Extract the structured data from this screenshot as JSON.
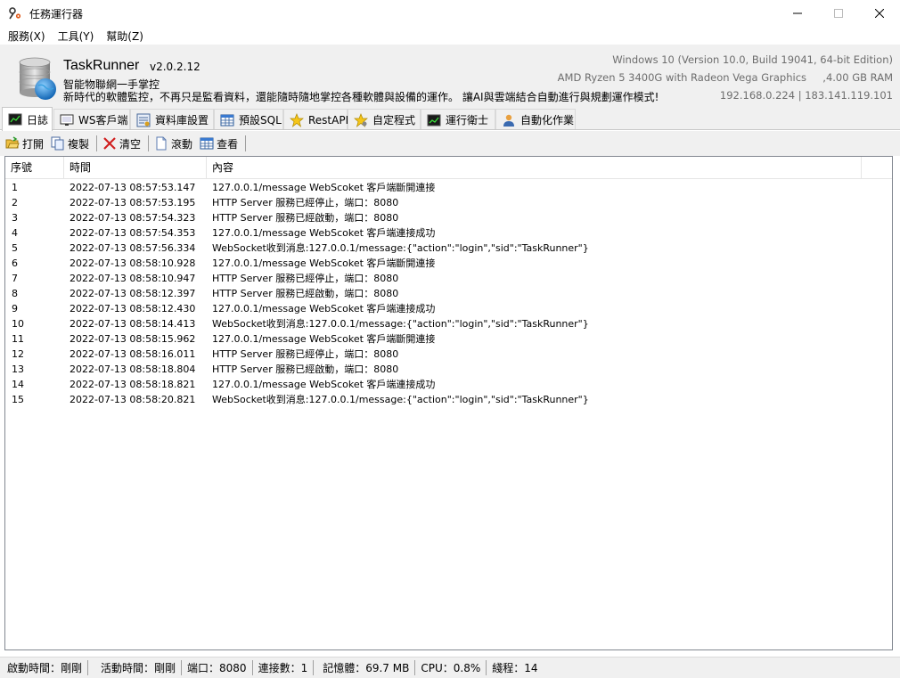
{
  "window": {
    "title": "任務運行器"
  },
  "menu": [
    {
      "label": "服務(X)"
    },
    {
      "label": "工具(Y)"
    },
    {
      "label": "幫助(Z)"
    }
  ],
  "header": {
    "app_name": "TaskRunner",
    "version": "v2.0.2.12",
    "slogan_line1": "智能物聯網一手掌控",
    "slogan_line2": "新時代的軟體監控，不再只是監看資料，還能隨時隨地掌控各種軟體與設備的運作。 讓AI與雲端結合自動進行與規劃運作模式!",
    "os_info": "Windows 10 (Version 10.0, Build 19041, 64-bit Edition)",
    "hw_info": "AMD Ryzen 5 3400G with Radeon Vega Graphics     ,4.00 GB RAM",
    "ip_info": "192.168.0.224 | 183.141.119.101"
  },
  "tabs": [
    {
      "label": "日誌",
      "icon": "log-icon"
    },
    {
      "label": "WS客戶端",
      "icon": "monitor-icon"
    },
    {
      "label": "資料庫設置",
      "icon": "database-settings-icon"
    },
    {
      "label": "預設SQL",
      "icon": "table-icon"
    },
    {
      "label": "RestAPI",
      "icon": "star-icon"
    },
    {
      "label": "自定程式",
      "icon": "star-gear-icon"
    },
    {
      "label": "運行衛士",
      "icon": "chart-icon"
    },
    {
      "label": "自動化作業",
      "icon": "user-icon"
    }
  ],
  "toolbar": {
    "open": "打開",
    "copy": "複製",
    "clear": "清空",
    "scroll": "滾動",
    "view": "查看"
  },
  "grid": {
    "columns": [
      "序號",
      "時間",
      "內容"
    ],
    "rows": [
      {
        "no": "1",
        "time": "2022-07-13 08:57:53.147",
        "content": "127.0.0.1/message WebScoket 客戶端斷開連接"
      },
      {
        "no": "2",
        "time": "2022-07-13 08:57:53.195",
        "content": "HTTP Server 服務已經停止，端口：8080"
      },
      {
        "no": "3",
        "time": "2022-07-13 08:57:54.323",
        "content": "HTTP Server 服務已經啟動，端口：8080"
      },
      {
        "no": "4",
        "time": "2022-07-13 08:57:54.353",
        "content": "127.0.0.1/message WebScoket 客戶端連接成功"
      },
      {
        "no": "5",
        "time": "2022-07-13 08:57:56.334",
        "content": "WebSocket收到消息:127.0.0.1/message:{\"action\":\"login\",\"sid\":\"TaskRunner\"}"
      },
      {
        "no": "6",
        "time": "2022-07-13 08:58:10.928",
        "content": "127.0.0.1/message WebScoket 客戶端斷開連接"
      },
      {
        "no": "7",
        "time": "2022-07-13 08:58:10.947",
        "content": "HTTP Server 服務已經停止，端口：8080"
      },
      {
        "no": "8",
        "time": "2022-07-13 08:58:12.397",
        "content": "HTTP Server 服務已經啟動，端口：8080"
      },
      {
        "no": "9",
        "time": "2022-07-13 08:58:12.430",
        "content": "127.0.0.1/message WebScoket 客戶端連接成功"
      },
      {
        "no": "10",
        "time": "2022-07-13 08:58:14.413",
        "content": "WebSocket收到消息:127.0.0.1/message:{\"action\":\"login\",\"sid\":\"TaskRunner\"}"
      },
      {
        "no": "11",
        "time": "2022-07-13 08:58:15.962",
        "content": "127.0.0.1/message WebScoket 客戶端斷開連接"
      },
      {
        "no": "12",
        "time": "2022-07-13 08:58:16.011",
        "content": "HTTP Server 服務已經停止，端口：8080"
      },
      {
        "no": "13",
        "time": "2022-07-13 08:58:18.804",
        "content": "HTTP Server 服務已經啟動，端口：8080"
      },
      {
        "no": "14",
        "time": "2022-07-13 08:58:18.821",
        "content": "127.0.0.1/message WebScoket 客戶端連接成功"
      },
      {
        "no": "15",
        "time": "2022-07-13 08:58:20.821",
        "content": "WebSocket收到消息:127.0.0.1/message:{\"action\":\"login\",\"sid\":\"TaskRunner\"}"
      }
    ]
  },
  "status": [
    {
      "label": "啟動時間：剛剛"
    },
    {
      "label": "活動時間：剛剛"
    },
    {
      "label": "端口：8080"
    },
    {
      "label": "連接數：1"
    },
    {
      "label": "記憶體：69.7 MB"
    },
    {
      "label": "CPU：0.8%"
    },
    {
      "label": "綫程：14"
    }
  ],
  "colors": {
    "chrome_bg": "#f0f0f0",
    "grid_border": "#828790",
    "muted_text": "#6d6d6d"
  }
}
